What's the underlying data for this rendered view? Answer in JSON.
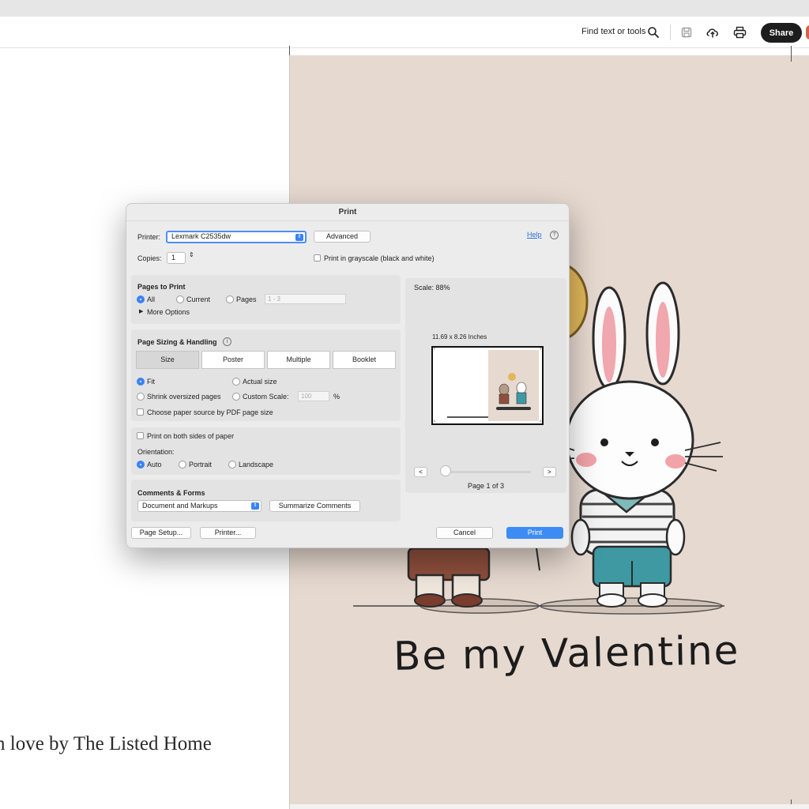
{
  "toolbar": {
    "find_label": "Find text or tools",
    "share_label": "Share",
    "icons": [
      "search-icon",
      "save-icon",
      "upload-cloud-icon",
      "printer-icon"
    ]
  },
  "document": {
    "credit_text": "n love by The Listed Home",
    "valentine_text": "Be my Valentine"
  },
  "dialog": {
    "title": "Print",
    "printer_label": "Printer:",
    "printer_value": "Lexmark C2535dw",
    "advanced_label": "Advanced",
    "help_label": "Help",
    "copies_label": "Copies:",
    "copies_value": "1",
    "grayscale_label": "Print in grayscale (black and white)",
    "pages_to_print": {
      "heading": "Pages to Print",
      "all": "All",
      "current": "Current",
      "pages": "Pages",
      "range_placeholder": "1 - 3",
      "more_options": "More Options"
    },
    "sizing": {
      "heading": "Page Sizing & Handling",
      "tabs": [
        "Size",
        "Poster",
        "Multiple",
        "Booklet"
      ],
      "fit": "Fit",
      "actual_size": "Actual size",
      "shrink": "Shrink oversized pages",
      "custom_scale": "Custom Scale:",
      "custom_scale_value": "100",
      "percent": "%",
      "paper_source": "Choose paper source by PDF page size"
    },
    "both_sides_label": "Print on both sides of paper",
    "orientation": {
      "label": "Orientation:",
      "auto": "Auto",
      "portrait": "Portrait",
      "landscape": "Landscape"
    },
    "comments": {
      "heading": "Comments & Forms",
      "select_value": "Document and Markups",
      "summarize": "Summarize Comments"
    },
    "preview": {
      "scale": "Scale:  88%",
      "dimensions": "11.69 x 8.26 Inches",
      "prev": "<",
      "next": ">",
      "page_label": "Page 1 of 3"
    },
    "page_setup": "Page Setup...",
    "printer_btn": "Printer...",
    "cancel": "Cancel",
    "print": "Print"
  },
  "colors": {
    "accent": "#3c8cf4",
    "share_bg": "#1d1d1d",
    "page_bg": "#e6d9d0"
  }
}
